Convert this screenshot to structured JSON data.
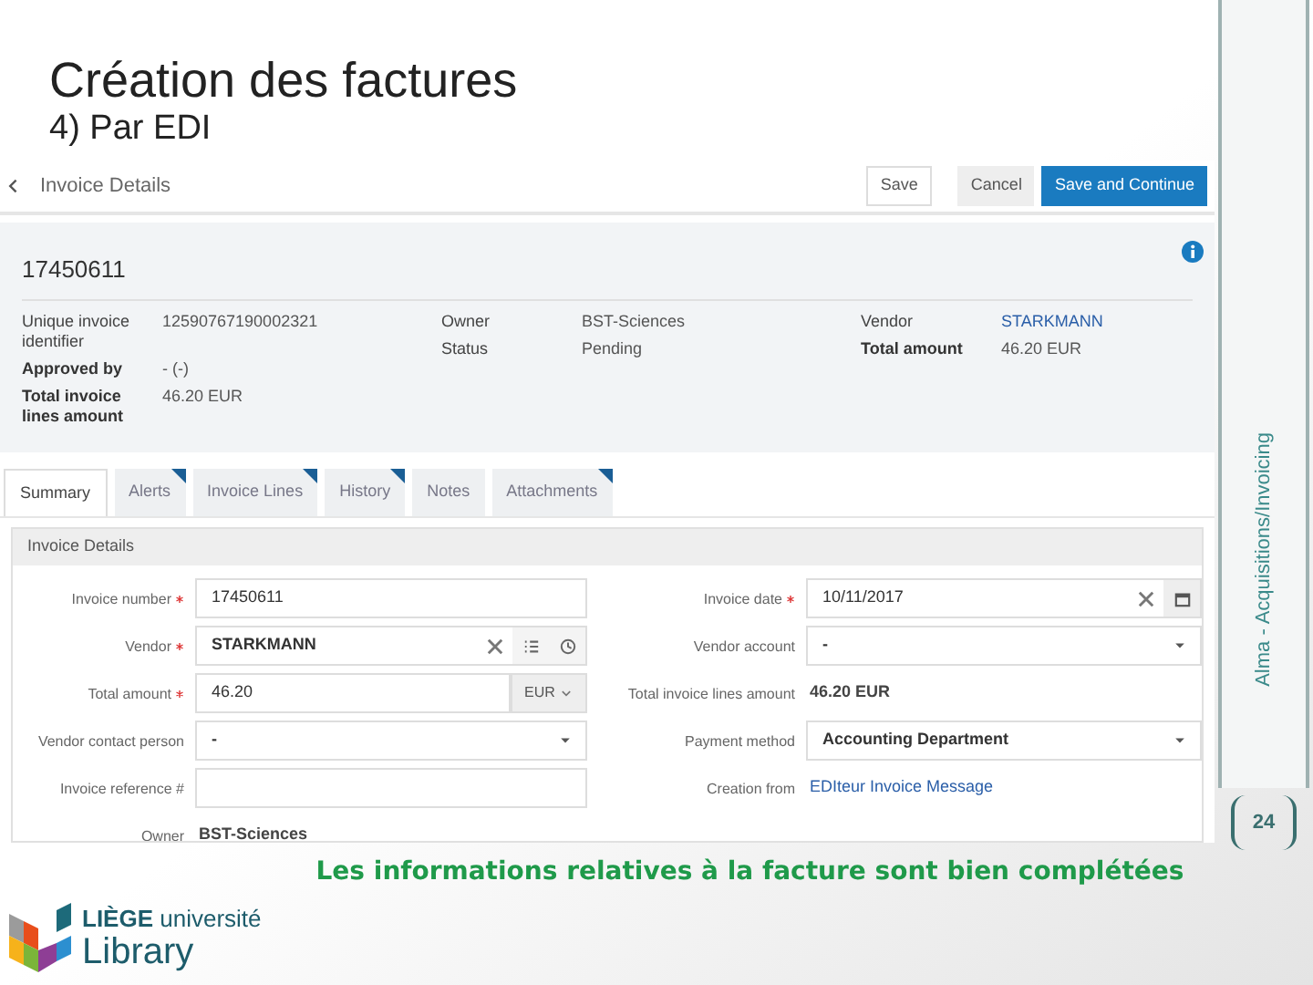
{
  "slide": {
    "title": "Création des factures",
    "subtitle": "4) Par EDI",
    "side_label": "Alma - Acquisitions/Invoicing",
    "page_number": "24",
    "caption": "Les informations relatives à la facture sont bien complétées",
    "logo": {
      "brand": "LIÈGE",
      "brand_rest": "université",
      "name": "Library"
    }
  },
  "screen": {
    "header": {
      "title": "Invoice Details",
      "buttons": [
        {
          "label": "Save",
          "kind": "plain"
        },
        {
          "label": "Cancel",
          "kind": "gray"
        },
        {
          "label": "Save and Continue",
          "kind": "primary"
        }
      ]
    },
    "summary": {
      "number": "17450611",
      "columns": [
        [
          {
            "label": "Unique invoice identifier",
            "value": "12590767190002321",
            "bold": false
          },
          {
            "label": "Approved by",
            "value": "- (-)",
            "bold": true
          },
          {
            "label": "Total invoice lines amount",
            "value": "46.20 EUR",
            "bold": true
          }
        ],
        [
          {
            "label": "Owner",
            "value": "BST-Sciences",
            "bold": false
          },
          {
            "label": "Status",
            "value": "Pending",
            "bold": false
          }
        ],
        [
          {
            "label": "Vendor",
            "value": "STARKMANN",
            "bold": false,
            "link": true
          },
          {
            "label": "Total amount",
            "value": "46.20 EUR",
            "bold": true
          }
        ]
      ]
    },
    "tabs": [
      {
        "label": "Summary",
        "selected": true,
        "flag": false
      },
      {
        "label": "Alerts",
        "selected": false,
        "flag": true
      },
      {
        "label": "Invoice Lines",
        "selected": false,
        "flag": true
      },
      {
        "label": "History",
        "selected": false,
        "flag": true
      },
      {
        "label": "Notes",
        "selected": false,
        "flag": false
      },
      {
        "label": "Attachments",
        "selected": false,
        "flag": true
      }
    ],
    "section": {
      "title": "Invoice Details",
      "left": [
        {
          "label": "Invoice number",
          "required": true,
          "kind": "input",
          "value": "17450611"
        },
        {
          "label": "Vendor",
          "required": true,
          "kind": "vendor",
          "value": "STARKMANN"
        },
        {
          "label": "Total amount",
          "required": true,
          "kind": "amount",
          "value": "46.20",
          "currency": "EUR"
        },
        {
          "label": "Vendor contact person",
          "required": false,
          "kind": "select",
          "value": "-"
        },
        {
          "label": "Invoice reference #",
          "required": false,
          "kind": "input"
        },
        {
          "label": "Owner",
          "required": false,
          "kind": "text",
          "value": "BST-Sciences"
        }
      ],
      "right": [
        {
          "label": "Invoice date",
          "required": true,
          "kind": "date",
          "value": "10/11/2017"
        },
        {
          "label": "Vendor account",
          "required": false,
          "kind": "select",
          "value": "-"
        },
        {
          "label": "Total invoice lines amount",
          "required": false,
          "kind": "text",
          "value": "46.20 EUR"
        },
        {
          "label": "Payment method",
          "required": false,
          "kind": "select",
          "value": "Accounting Department"
        },
        {
          "label": "Creation from",
          "required": false,
          "kind": "link",
          "value": "EDIteur Invoice Message"
        }
      ]
    }
  }
}
